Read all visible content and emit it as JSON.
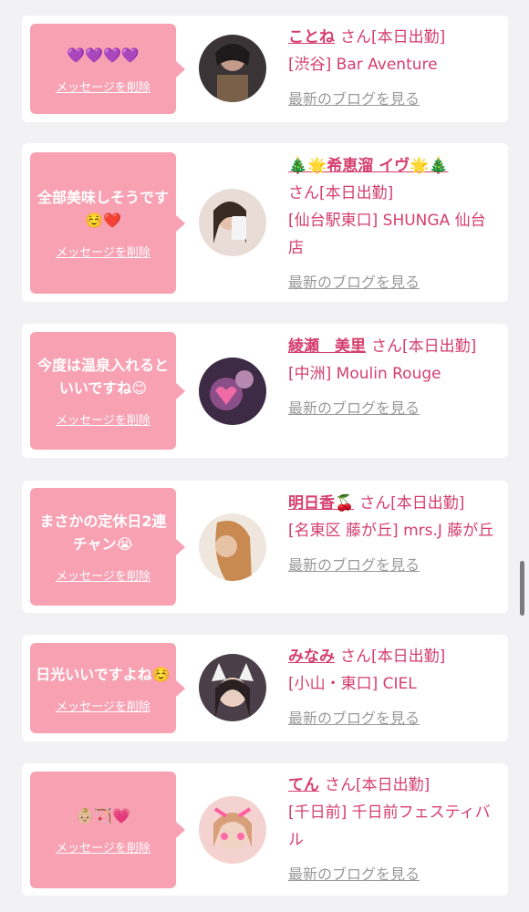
{
  "delete_label": "メッセージを削除",
  "blog_label": "最新のブログを見る",
  "suffix": "さん[本日出勤]",
  "cards": [
    {
      "message": "💜💜💜💜",
      "name": "ことね",
      "shop": "[渋谷] Bar Aventure"
    },
    {
      "message": "全部美味しそうです☺️❤️",
      "name": "🎄🌟希恵溜 イヴ🌟🎄",
      "shop": "[仙台駅東口] SHUNGA 仙台店"
    },
    {
      "message": "今度は温泉入れるといいですね😊",
      "name": "綾瀬　美里",
      "shop": "[中洲] Moulin Rouge"
    },
    {
      "message": "まさかの定休日2連チャン😭",
      "name": "明日香🍒",
      "shop": "[名東区 藤が丘] mrs.J 藤が丘"
    },
    {
      "message": "日光いいですよね☺️",
      "name": "みなみ",
      "shop": "[小山・東口] CIEL"
    },
    {
      "message": "👶🏼🏹💗",
      "name": "てん",
      "shop": "[千日前] 千日前フェスティバル"
    }
  ],
  "colors": {
    "bubble": "#f7a1b3",
    "accent": "#d53e6e",
    "link_gray": "#999999"
  }
}
